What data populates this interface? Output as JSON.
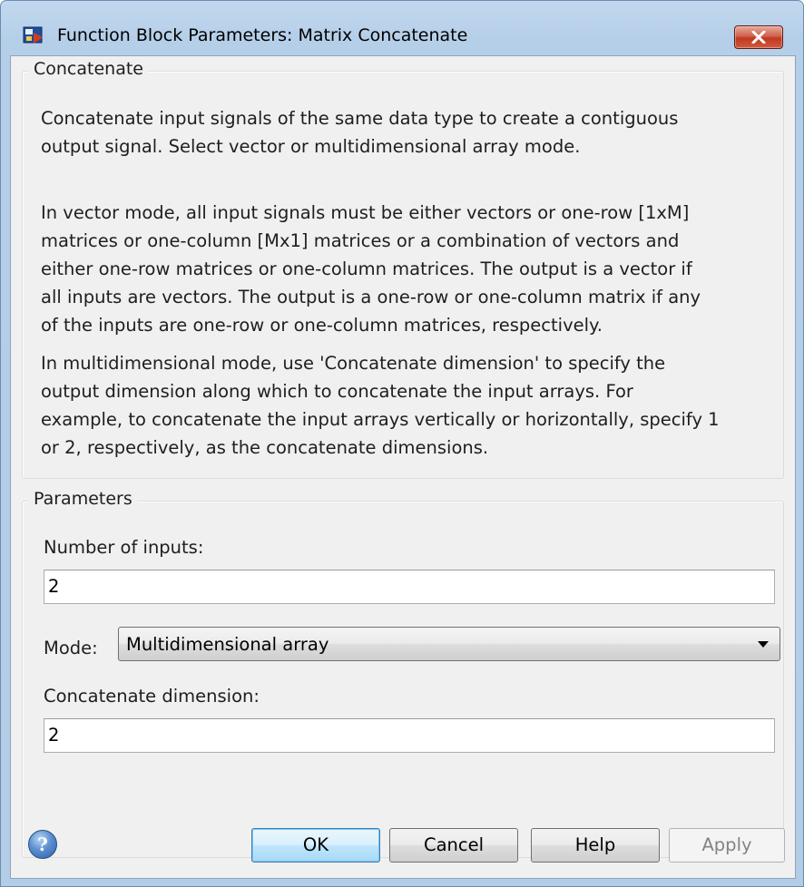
{
  "window": {
    "title": "Function Block Parameters: Matrix Concatenate",
    "app_icon": "simulink-block-icon",
    "close_icon": "close-x-icon",
    "colors": {
      "titlebar": "#b9d1ea",
      "close_button": "#c7432a",
      "client_background": "#f0f0f0"
    }
  },
  "concatenate_group": {
    "title": "Concatenate",
    "paragraph_1": "Concatenate input signals of the same data type to create a contiguous\noutput signal. Select vector or multidimensional array mode.",
    "paragraph_2": "In vector mode, all input signals must be either vectors or one-row [1xM]\nmatrices or one-column [Mx1] matrices or a combination of vectors and\neither one-row matrices or one-column matrices. The output is a vector if\nall inputs are vectors. The output is a one-row or one-column matrix if any\nof the inputs are one-row or one-column matrices, respectively.",
    "paragraph_3": "In multidimensional mode, use 'Concatenate dimension' to specify the\noutput dimension along which to concatenate the input arrays. For\nexample, to concatenate the input arrays vertically or horizontally, specify 1\nor 2, respectively, as the concatenate dimensions."
  },
  "parameters_group": {
    "title": "Parameters",
    "number_of_inputs_label": "Number of inputs:",
    "number_of_inputs_value": "2",
    "mode_label": "Mode:",
    "mode_value": "Multidimensional array",
    "concatenate_dimension_label": "Concatenate dimension:",
    "concatenate_dimension_value": "2"
  },
  "footer": {
    "help_icon": "question-mark-icon",
    "help_glyph": "?",
    "ok_label": "OK",
    "cancel_label": "Cancel",
    "help_label": "Help",
    "apply_label": "Apply"
  }
}
